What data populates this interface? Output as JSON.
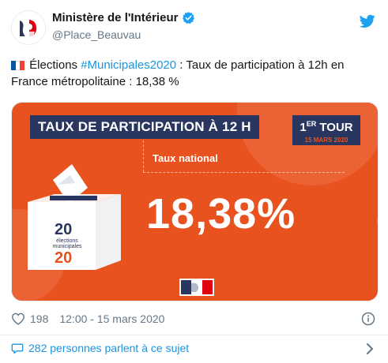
{
  "account": {
    "name": "Ministère de l'Intérieur",
    "handle": "@Place_Beauvau"
  },
  "tweet": {
    "text_before": " Élections ",
    "hashtag": "#Municipales2020",
    "text_after": " : Taux de participation à 12h en France métropolitaine : 18,38 %"
  },
  "media": {
    "banner": "TAUX DE PARTICIPATION À 12 H",
    "tour_number": "1",
    "tour_suffix": "ER",
    "tour_word": " TOUR",
    "tour_date": "15 MARS 2020",
    "label": "Taux national",
    "value": "18,38%",
    "year_top": "20",
    "year_bottom": "20",
    "elections_word": "élections municipales"
  },
  "footer": {
    "likes": "198",
    "timestamp": "12:00 - 15 mars 2020",
    "conversation": "282 personnes parlent à ce sujet"
  },
  "colors": {
    "orange": "#e8521f",
    "navy": "#29365f",
    "link_blue": "#1b95e0",
    "gray": "#657786"
  }
}
